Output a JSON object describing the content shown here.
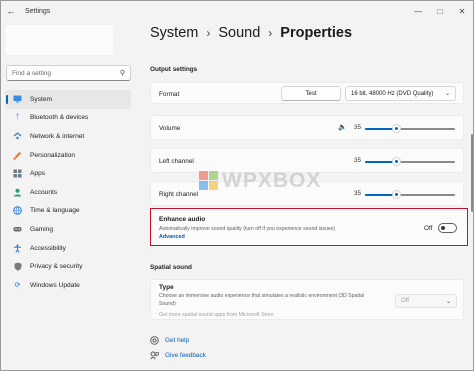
{
  "window": {
    "title": "Settings"
  },
  "search": {
    "placeholder": "Find a setting"
  },
  "sidebar": {
    "items": [
      {
        "label": "System",
        "icon": "monitor-icon",
        "active": true
      },
      {
        "label": "Bluetooth & devices",
        "icon": "bluetooth-icon"
      },
      {
        "label": "Network & internet",
        "icon": "network-icon"
      },
      {
        "label": "Personalization",
        "icon": "brush-icon"
      },
      {
        "label": "Apps",
        "icon": "apps-icon"
      },
      {
        "label": "Accounts",
        "icon": "person-icon"
      },
      {
        "label": "Time & language",
        "icon": "globe-icon"
      },
      {
        "label": "Gaming",
        "icon": "gamepad-icon"
      },
      {
        "label": "Accessibility",
        "icon": "accessibility-icon"
      },
      {
        "label": "Privacy & security",
        "icon": "shield-icon"
      },
      {
        "label": "Windows Update",
        "icon": "update-icon"
      }
    ]
  },
  "breadcrumb": {
    "level1": "System",
    "level2": "Sound",
    "current": "Properties"
  },
  "output": {
    "section_title": "Output settings",
    "format": {
      "label": "Format",
      "test_button": "Test",
      "value": "16 bit, 48000 Hz (DVD Quality)"
    },
    "volume": {
      "label": "Volume",
      "value": "35",
      "level": 0.35
    },
    "left_channel": {
      "label": "Left channel",
      "value": "35",
      "level": 0.35
    },
    "right_channel": {
      "label": "Right channel",
      "value": "35",
      "level": 0.35
    }
  },
  "enhance": {
    "title": "Enhance audio",
    "description": "Automatically improve sound quality (turn off if you experience sound issues)",
    "link": "Advanced",
    "state": "Off"
  },
  "spatial": {
    "section_title": "Spatial sound",
    "type": {
      "title": "Type",
      "description": "Choose an immersive audio experience that simulates a realistic environment (3D Spatial Sound)",
      "store_link": "Get more spatial sound apps from Microsoft Store",
      "value": "Off"
    }
  },
  "help": {
    "get_help": "Get help",
    "feedback": "Give feedback"
  },
  "watermark": {
    "text": "WPXBOX"
  },
  "colors": {
    "accent": "#0067c0",
    "link": "#005fb8",
    "highlight_border": "#c8102e"
  }
}
